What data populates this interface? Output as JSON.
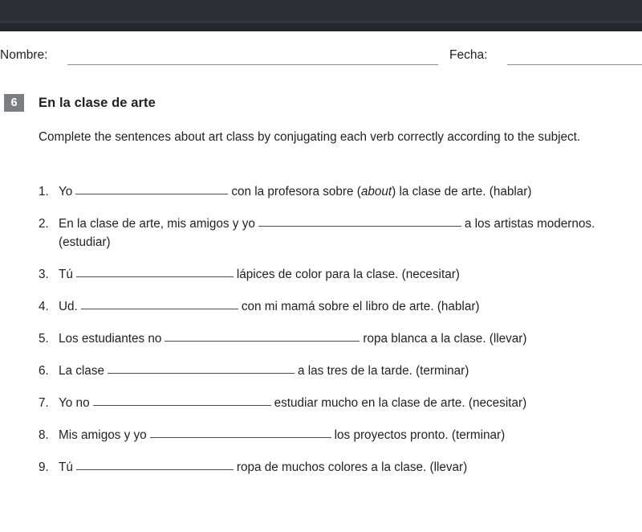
{
  "window": {
    "clipped_toolbar_text": "",
    "chrome_color": "#2b2e34"
  },
  "header_fields": {
    "name_label": "Nombre:",
    "date_label": "Fecha:",
    "name_value": "",
    "date_value": ""
  },
  "exercise": {
    "number": "6",
    "number_badge_color": "#7b7e81",
    "title": "En la clase de arte",
    "instructions": "Complete the sentences about art class by conjugating each verb correctly according to the subject.",
    "items": [
      {
        "number": "1.",
        "before": "Yo",
        "blank_width": 190,
        "after_parts": [
          {
            "text": "con la profesora sobre (",
            "italic": false
          },
          {
            "text": "about",
            "italic": true
          },
          {
            "text": ") la clase de arte. (hablar)",
            "italic": false
          }
        ],
        "plain_text": "Yo ____________ con la profesora sobre (about) la clase de arte. (hablar)"
      },
      {
        "number": "2.",
        "before": "En la clase de arte, mis amigos y yo",
        "blank_width": 253,
        "after_parts": [
          {
            "text": "a los artistas modernos. (estudiar)",
            "italic": false
          }
        ],
        "plain_text": "En la clase de arte, mis amigos y yo ____________ a los artistas modernos. (estudiar)"
      },
      {
        "number": "3.",
        "before": "Tú",
        "blank_width": 196,
        "after_parts": [
          {
            "text": "lápices de color para la clase. (necesitar)",
            "italic": false
          }
        ],
        "plain_text": "Tú ____________ lápices de color para la clase. (necesitar)"
      },
      {
        "number": "4.",
        "before": "Ud.",
        "blank_width": 196,
        "after_parts": [
          {
            "text": "con mi mamá sobre el libro de arte. (hablar)",
            "italic": false
          }
        ],
        "plain_text": "Ud. ____________ con mi mamá sobre el libro de arte. (hablar)"
      },
      {
        "number": "5.",
        "before": "Los estudiantes no",
        "blank_width": 243,
        "after_parts": [
          {
            "text": "ropa blanca a la clase. (llevar)",
            "italic": false
          }
        ],
        "plain_text": "Los estudiantes no ____________ ropa blanca a la clase. (llevar)"
      },
      {
        "number": "6.",
        "before": "La clase",
        "blank_width": 233,
        "after_parts": [
          {
            "text": "a las tres de la tarde. (terminar)",
            "italic": false
          }
        ],
        "plain_text": "La clase ____________ a las tres de la tarde. (terminar)"
      },
      {
        "number": "7.",
        "before": "Yo no",
        "blank_width": 222,
        "after_parts": [
          {
            "text": "estudiar mucho en la clase de arte. (necesitar)",
            "italic": false
          }
        ],
        "plain_text": "Yo no ____________ estudiar mucho en la clase de arte. (necesitar)"
      },
      {
        "number": "8.",
        "before": "Mis amigos y yo",
        "blank_width": 226,
        "after_parts": [
          {
            "text": "los proyectos pronto. (terminar)",
            "italic": false
          }
        ],
        "plain_text": "Mis amigos y yo ____________ los proyectos pronto. (terminar)"
      },
      {
        "number": "9.",
        "before": "Tú",
        "blank_width": 196,
        "after_parts": [
          {
            "text": "ropa de muchos colores a la clase. (llevar)",
            "italic": false
          }
        ],
        "plain_text": "Tú ____________ ropa de muchos colores a la clase. (llevar)"
      }
    ]
  }
}
